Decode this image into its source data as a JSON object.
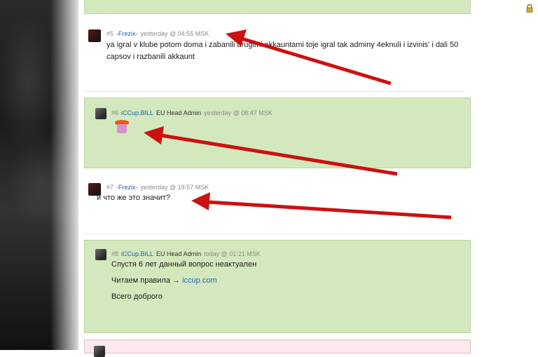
{
  "posts": [
    {
      "num": "#5",
      "name": "-Frezix-",
      "role": "",
      "time": "yesterday @ 04:55 MSK",
      "text": "ya igral v klube potom doma i zabanili drugimi akkauntami toje igral tak adminy 4eknuli i izvinis' i dali 50 capsov i razbanili akkaunt"
    },
    {
      "num": "#6",
      "name": "iCCup.BILL",
      "role": "EU Head Admin",
      "time": "yesterday @ 08:47 MSK",
      "text": ""
    },
    {
      "num": "#7",
      "name": "-Frezix-",
      "role": "",
      "time": "yesterday @ 18:57 MSK",
      "text": "и что же это значит?"
    },
    {
      "num": "#8",
      "name": "iCCup.BILL",
      "role": "EU Head Admin",
      "time": "today @ 01:21 MSK",
      "line1": "Спустя 6 лет данный вопрос неактуален",
      "line2_prefix": "Читаем правила →",
      "line2_link": "iccup.com",
      "line3": "Всего доброго"
    }
  ],
  "colors": {
    "admin_bg": "#d3e8bd",
    "link": "#2a62b8",
    "arrow": "#cc1111"
  },
  "icons": [
    "lock-icon",
    "emoji-sticker-icon",
    "avatar"
  ]
}
